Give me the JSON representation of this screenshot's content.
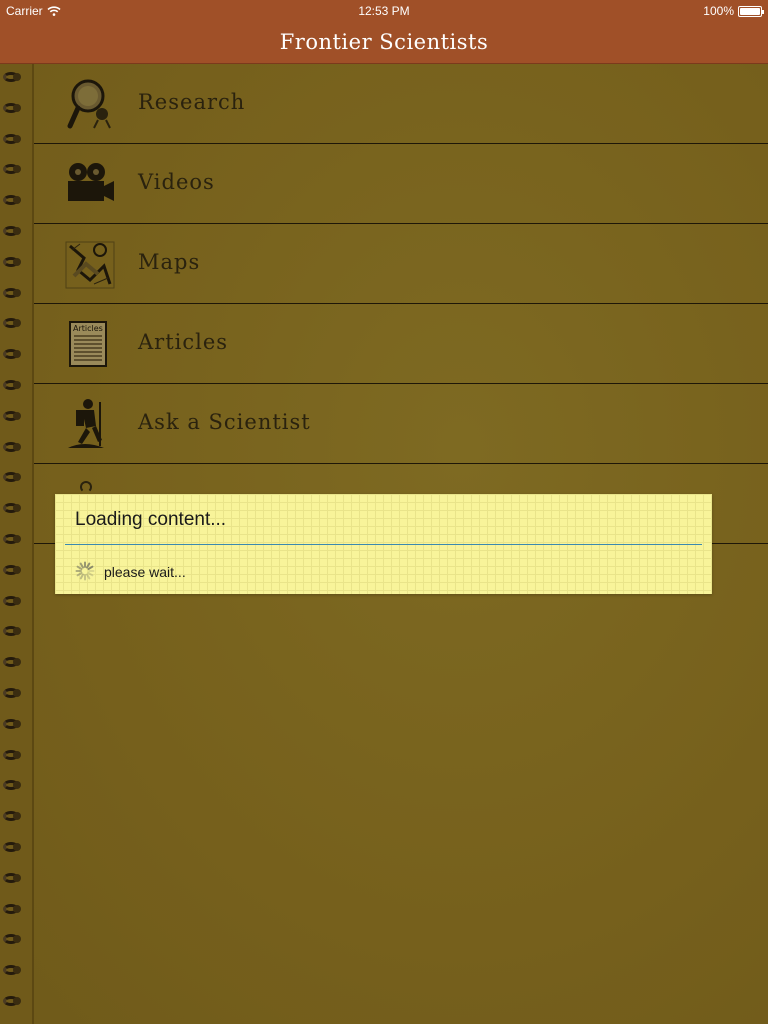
{
  "status_bar": {
    "carrier": "Carrier",
    "time": "12:53 PM",
    "battery": "100%",
    "battery_level": 1.0
  },
  "nav": {
    "title": "Frontier Scientists"
  },
  "menu": {
    "items": [
      {
        "label": "Research",
        "icon": "magnifier-icon"
      },
      {
        "label": "Videos",
        "icon": "film-camera-icon"
      },
      {
        "label": "Maps",
        "icon": "map-icon"
      },
      {
        "label": "Articles",
        "icon": "articles-icon"
      },
      {
        "label": "Ask a Scientist",
        "icon": "hiker-icon"
      }
    ]
  },
  "dialog": {
    "title": "Loading content...",
    "message": "please wait..."
  },
  "colors": {
    "nav_bar": "#a05028",
    "paper": "#7a6420",
    "dialog_bg": "#f8f49a",
    "divider": "#3a8ab0"
  }
}
